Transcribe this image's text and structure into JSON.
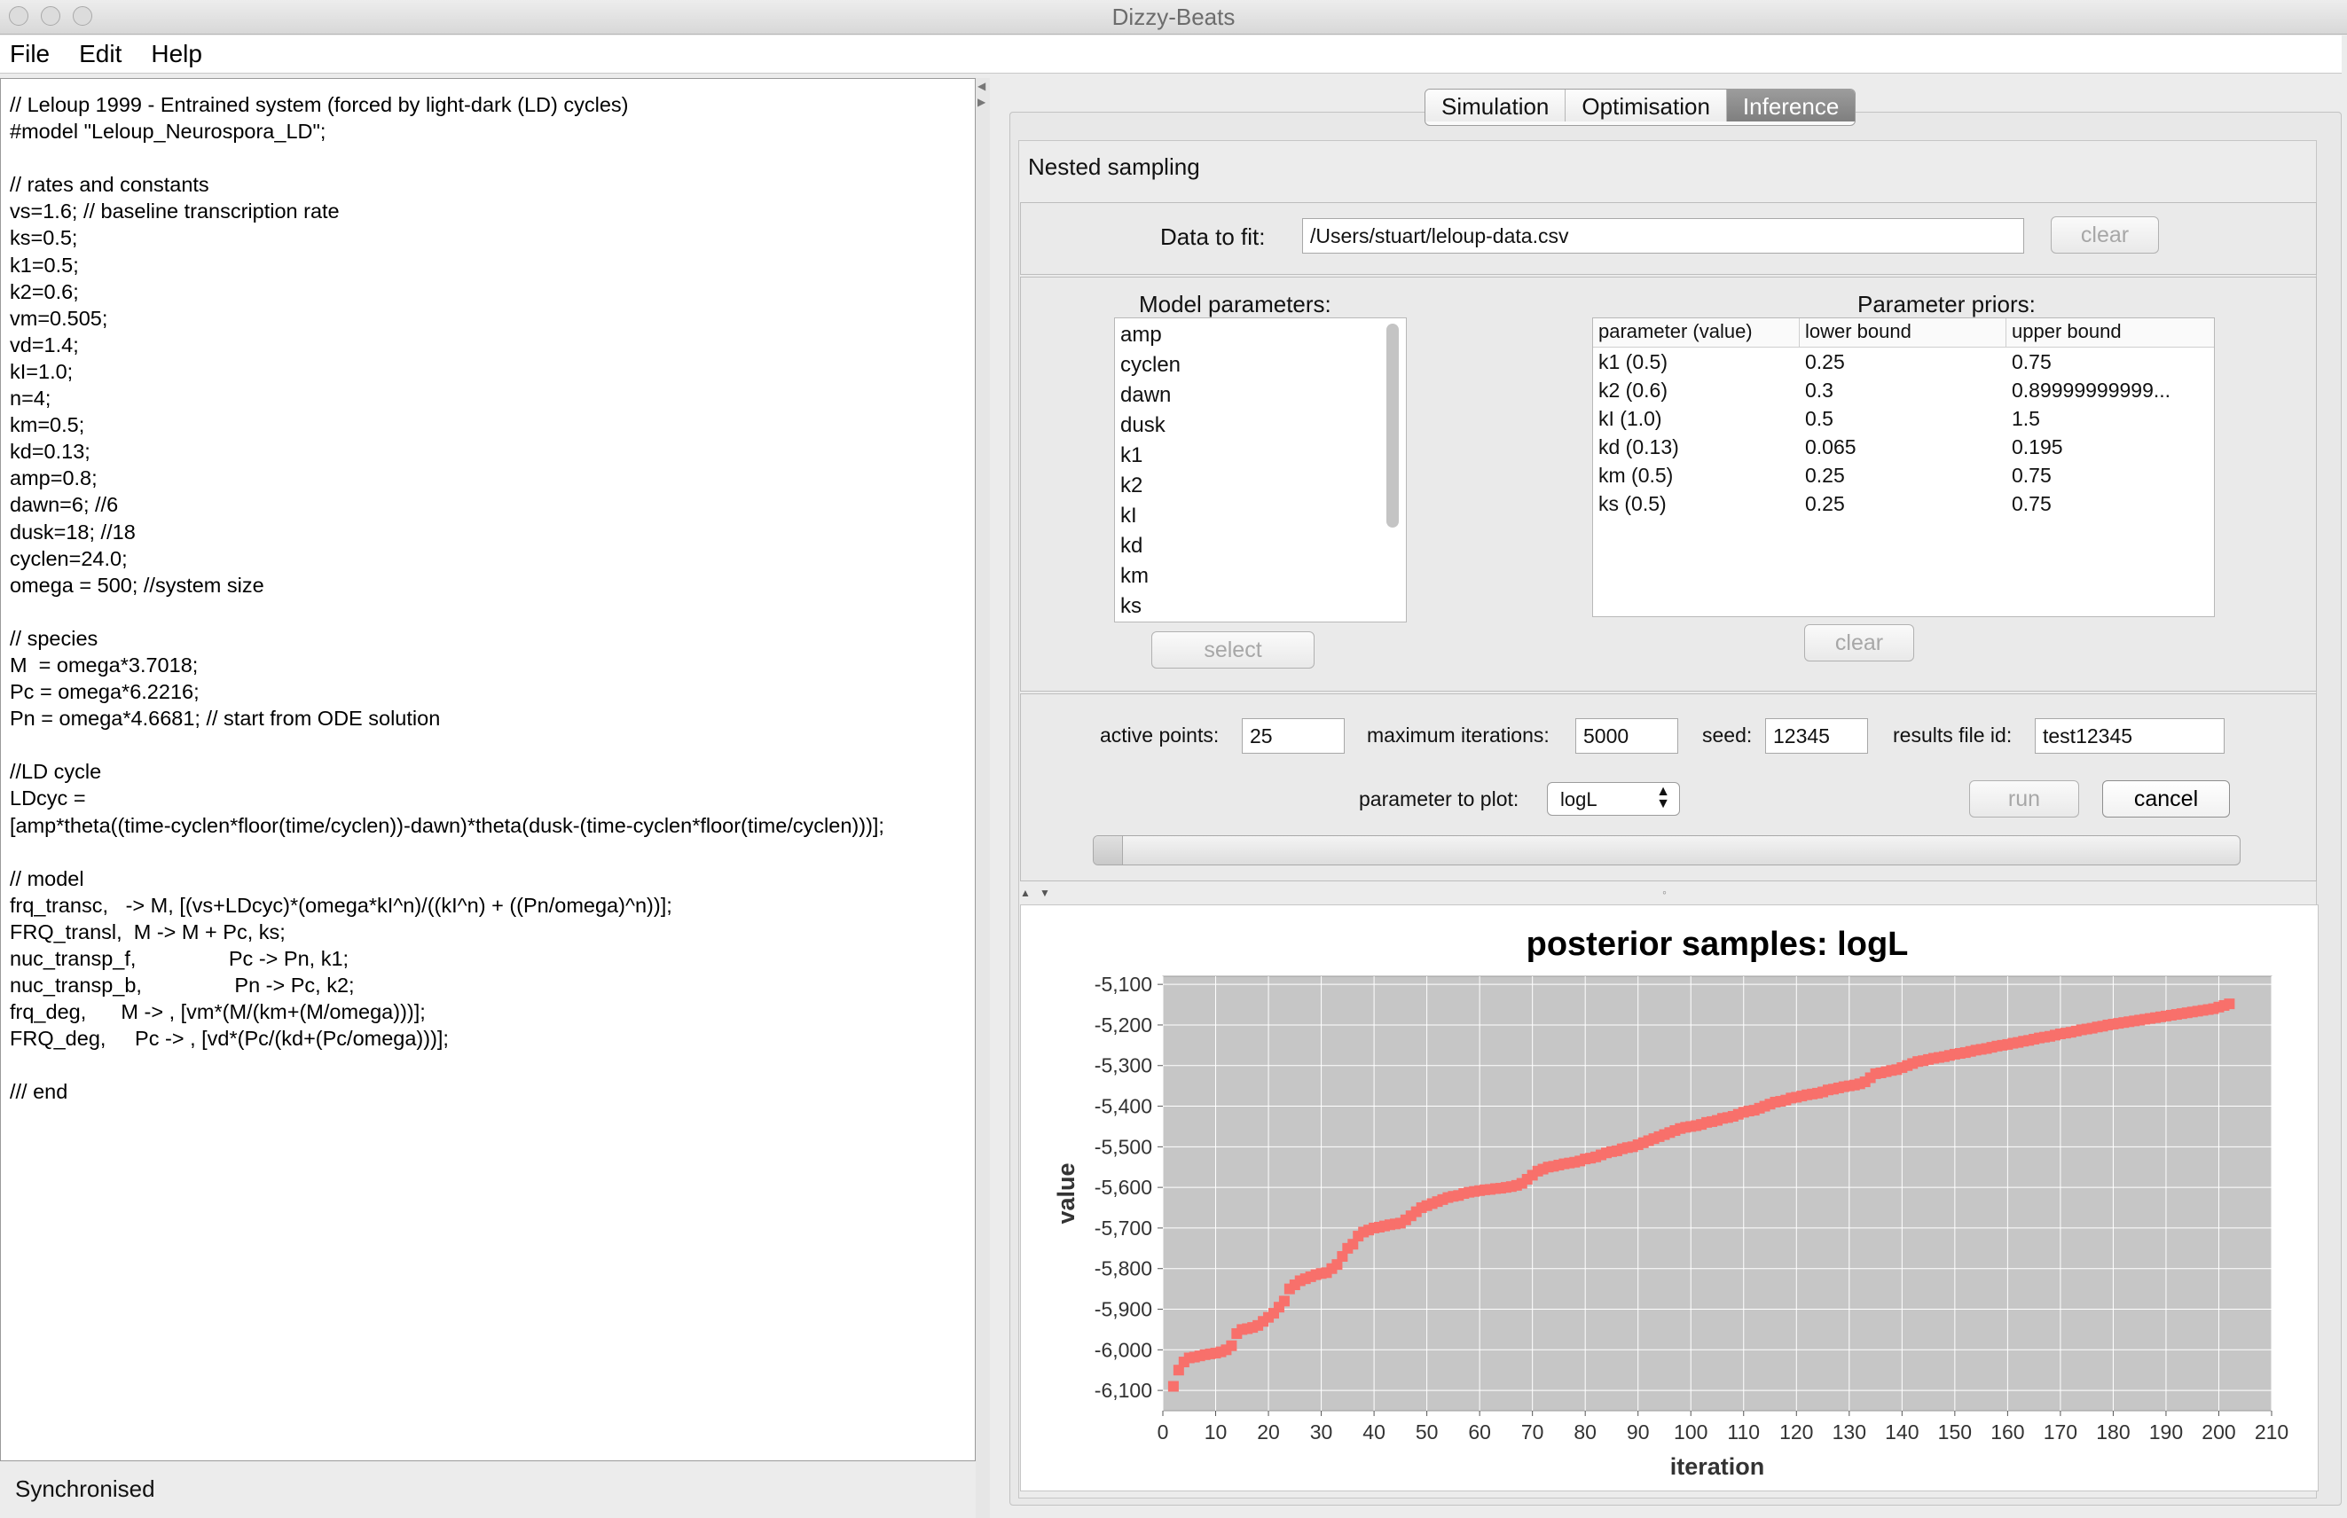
{
  "window": {
    "title": "Dizzy-Beats"
  },
  "menu": [
    "File",
    "Edit",
    "Help"
  ],
  "editor": {
    "code": "// Leloup 1999 - Entrained system (forced by light-dark (LD) cycles)\n#model \"Leloup_Neurospora_LD\";\n\n// rates and constants\nvs=1.6; // baseline transcription rate\nks=0.5;\nk1=0.5;\nk2=0.6;\nvm=0.505;\nvd=1.4;\nkI=1.0;\nn=4;\nkm=0.5;\nkd=0.13;\namp=0.8;\ndawn=6; //6\ndusk=18; //18\ncyclen=24.0;\nomega = 500; //system size\n\n// species\nM  = omega*3.7018;\nPc = omega*6.2216;\nPn = omega*4.6681; // start from ODE solution\n\n//LD cycle\nLDcyc =\n[amp*theta((time-cyclen*floor(time/cyclen))-dawn)*theta(dusk-(time-cyclen*floor(time/cyclen)))];\n\n// model\nfrq_transc,   -> M, [(vs+LDcyc)*(omega*kI^n)/((kI^n) + ((Pn/omega)^n))];\nFRQ_transl,  M -> M + Pc, ks;\nnuc_transp_f,                Pc -> Pn, k1;\nnuc_transp_b,                Pn -> Pc, k2;\nfrq_deg,      M -> , [vm*(M/(km+(M/omega)))];\nFRQ_deg,     Pc -> , [vd*(Pc/(kd+(Pc/omega)))];\n\n/// end"
  },
  "status": "Synchronised",
  "tabs": [
    "Simulation",
    "Optimisation",
    "Inference"
  ],
  "active_tab": "Inference",
  "inference": {
    "section_title": "Nested sampling",
    "data_label": "Data to fit:",
    "data_value": "/Users/stuart/leloup-data.csv",
    "data_clear": "clear",
    "model_params_label": "Model parameters:",
    "model_params": [
      "amp",
      "cyclen",
      "dawn",
      "dusk",
      "k1",
      "k2",
      "kI",
      "kd",
      "km",
      "ks"
    ],
    "select_button": "select",
    "priors_label": "Parameter priors:",
    "priors_headers": [
      "parameter (value)",
      "lower bound",
      "upper bound"
    ],
    "priors_rows": [
      [
        "k1 (0.5)",
        "0.25",
        "0.75"
      ],
      [
        "k2 (0.6)",
        "0.3",
        "0.89999999999..."
      ],
      [
        "kI (1.0)",
        "0.5",
        "1.5"
      ],
      [
        "kd (0.13)",
        "0.065",
        "0.195"
      ],
      [
        "km (0.5)",
        "0.25",
        "0.75"
      ],
      [
        "ks (0.5)",
        "0.25",
        "0.75"
      ]
    ],
    "priors_clear": "clear",
    "active_points_label": "active points:",
    "active_points": "25",
    "max_iter_label": "maximum iterations:",
    "max_iter": "5000",
    "seed_label": "seed:",
    "seed": "12345",
    "results_label": "results file id:",
    "results_id": "test12345",
    "plot_param_label": "parameter to plot:",
    "plot_param": "logL",
    "run_button": "run",
    "cancel_button": "cancel",
    "progress": 0.025
  },
  "chart_data": {
    "type": "scatter",
    "title": "posterior samples: logL",
    "xlabel": "iteration",
    "ylabel": "value",
    "xlim": [
      0,
      210
    ],
    "ylim": [
      -6150,
      -5080
    ],
    "xticks": [
      0,
      10,
      20,
      30,
      40,
      50,
      60,
      70,
      80,
      90,
      100,
      110,
      120,
      130,
      140,
      150,
      160,
      170,
      180,
      190,
      200,
      210
    ],
    "yticks": [
      -6100,
      -6000,
      -5900,
      -5800,
      -5700,
      -5600,
      -5500,
      -5400,
      -5300,
      -5200,
      -5100
    ],
    "ytick_labels": [
      "-6,100",
      "-6,000",
      "-5,900",
      "-5,800",
      "-5,700",
      "-5,600",
      "-5,500",
      "-5,400",
      "-5,300",
      "-5,200",
      "-5,100"
    ],
    "grid": true,
    "legend": "bottom-center",
    "series": [
      {
        "name": "logL",
        "color": "#f8706b",
        "x": [
          2,
          3,
          4,
          5,
          6,
          7,
          8,
          9,
          10,
          11,
          12,
          13,
          14,
          15,
          16,
          17,
          18,
          19,
          20,
          21,
          22,
          23,
          24,
          25,
          26,
          27,
          28,
          29,
          30,
          31,
          32,
          33,
          34,
          35,
          36,
          37,
          38,
          39,
          40,
          41,
          42,
          43,
          44,
          45,
          46,
          47,
          48,
          49,
          50,
          51,
          52,
          53,
          54,
          55,
          56,
          57,
          58,
          59,
          60,
          61,
          62,
          63,
          64,
          65,
          66,
          67,
          68,
          69,
          70,
          71,
          72,
          73,
          74,
          75,
          76,
          77,
          78,
          79,
          80,
          81,
          82,
          83,
          84,
          85,
          86,
          87,
          88,
          89,
          90,
          91,
          92,
          93,
          94,
          95,
          96,
          97,
          98,
          99,
          100,
          101,
          102,
          103,
          104,
          105,
          106,
          107,
          108,
          109,
          110,
          111,
          112,
          113,
          114,
          115,
          116,
          117,
          118,
          119,
          120,
          121,
          122,
          123,
          124,
          125,
          126,
          127,
          128,
          129,
          130,
          131,
          132,
          133,
          134,
          135,
          136,
          137,
          138,
          139,
          140,
          141,
          142,
          143,
          144,
          145,
          146,
          147,
          148,
          149,
          150,
          151,
          152,
          153,
          154,
          155,
          156,
          157,
          158,
          159,
          160,
          161,
          162,
          163,
          164,
          165,
          166,
          167,
          168,
          169,
          170,
          171,
          172,
          173,
          174,
          175,
          176,
          177,
          178,
          179,
          180,
          181,
          182,
          183,
          184,
          185,
          186,
          187,
          188,
          189,
          190,
          191,
          192,
          193,
          194,
          195,
          196,
          197,
          198,
          199,
          200,
          201,
          202
        ],
        "y": [
          -6090,
          -6050,
          -6030,
          -6020,
          -6018,
          -6015,
          -6012,
          -6010,
          -6008,
          -6005,
          -6000,
          -5990,
          -5960,
          -5950,
          -5948,
          -5945,
          -5940,
          -5930,
          -5920,
          -5910,
          -5895,
          -5880,
          -5850,
          -5840,
          -5830,
          -5825,
          -5820,
          -5815,
          -5812,
          -5810,
          -5800,
          -5790,
          -5770,
          -5750,
          -5740,
          -5720,
          -5710,
          -5705,
          -5700,
          -5698,
          -5695,
          -5692,
          -5690,
          -5688,
          -5680,
          -5670,
          -5660,
          -5650,
          -5645,
          -5640,
          -5635,
          -5630,
          -5625,
          -5622,
          -5620,
          -5615,
          -5612,
          -5610,
          -5608,
          -5606,
          -5605,
          -5603,
          -5602,
          -5600,
          -5598,
          -5595,
          -5590,
          -5580,
          -5570,
          -5560,
          -5555,
          -5550,
          -5548,
          -5545,
          -5542,
          -5540,
          -5538,
          -5535,
          -5530,
          -5528,
          -5525,
          -5520,
          -5515,
          -5512,
          -5510,
          -5505,
          -5502,
          -5500,
          -5495,
          -5490,
          -5485,
          -5480,
          -5475,
          -5470,
          -5465,
          -5460,
          -5455,
          -5452,
          -5450,
          -5448,
          -5445,
          -5440,
          -5438,
          -5435,
          -5430,
          -5428,
          -5425,
          -5420,
          -5415,
          -5412,
          -5410,
          -5405,
          -5400,
          -5395,
          -5390,
          -5388,
          -5385,
          -5380,
          -5378,
          -5375,
          -5372,
          -5370,
          -5368,
          -5365,
          -5360,
          -5358,
          -5355,
          -5352,
          -5350,
          -5348,
          -5345,
          -5340,
          -5330,
          -5320,
          -5318,
          -5315,
          -5312,
          -5310,
          -5305,
          -5300,
          -5295,
          -5290,
          -5288,
          -5285,
          -5282,
          -5280,
          -5278,
          -5275,
          -5272,
          -5270,
          -5268,
          -5265,
          -5262,
          -5260,
          -5258,
          -5255,
          -5252,
          -5250,
          -5248,
          -5245,
          -5243,
          -5240,
          -5238,
          -5235,
          -5232,
          -5230,
          -5228,
          -5225,
          -5222,
          -5220,
          -5218,
          -5215,
          -5212,
          -5210,
          -5208,
          -5205,
          -5203,
          -5200,
          -5198,
          -5196,
          -5194,
          -5192,
          -5190,
          -5188,
          -5186,
          -5184,
          -5182,
          -5180,
          -5178,
          -5176,
          -5174,
          -5172,
          -5170,
          -5168,
          -5166,
          -5164,
          -5162,
          -5160,
          -5156,
          -5152,
          -5148
        ]
      }
    ]
  }
}
